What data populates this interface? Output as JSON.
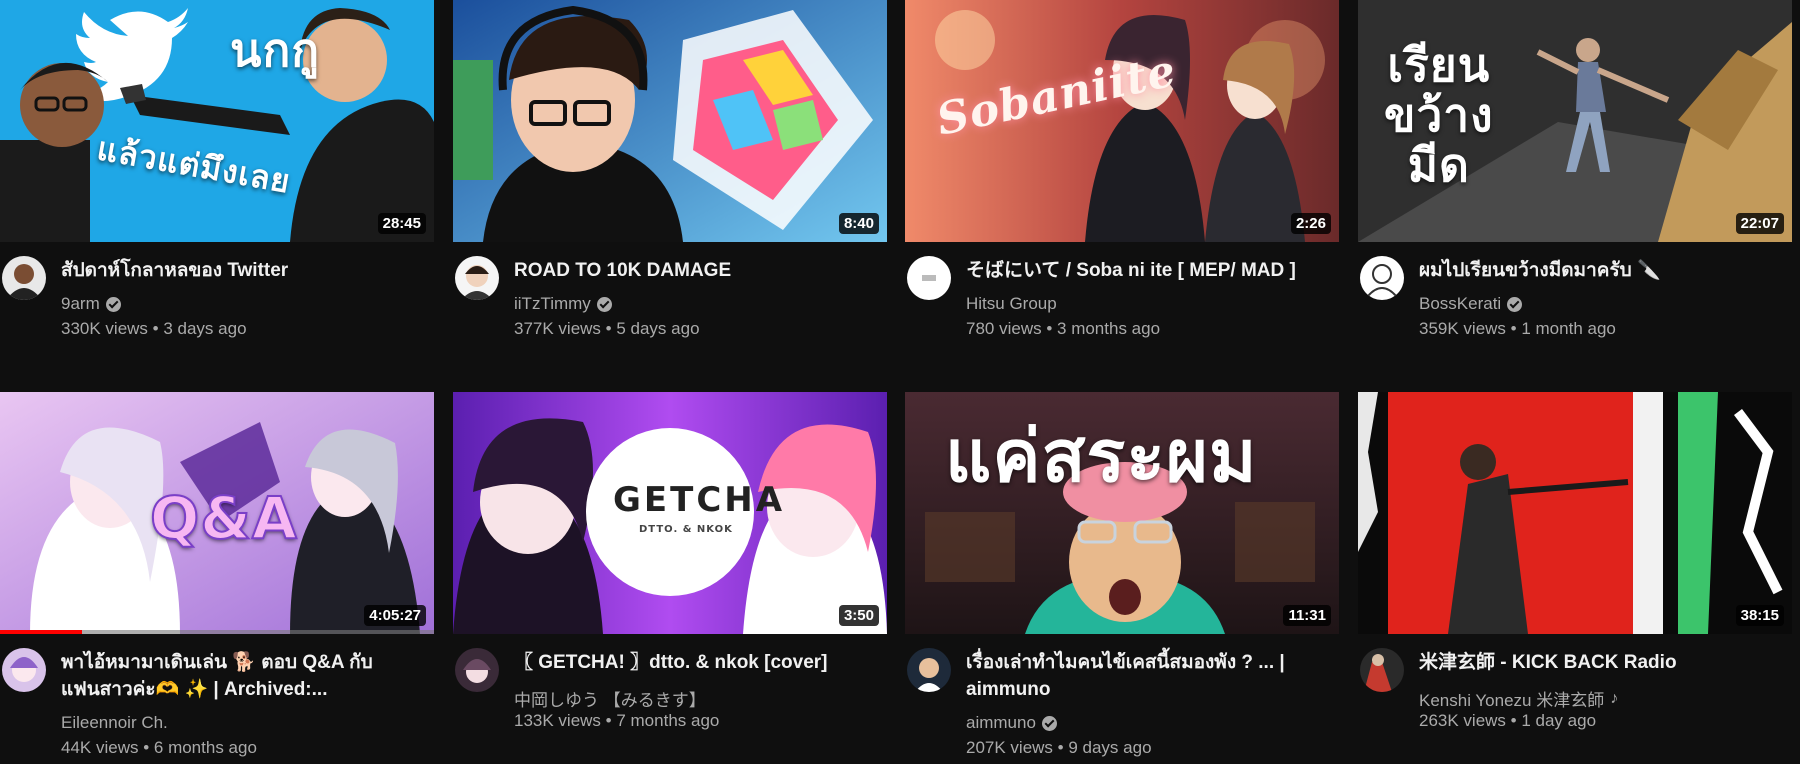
{
  "videos": [
    {
      "title": "สัปดาห์โกลาหลของ Twitter",
      "channel": "9arm",
      "verified": true,
      "views": "330K views",
      "age": "3 days ago",
      "duration": "28:45",
      "thumb_text": "นกกู",
      "thumb_text2": "แล้วแต่มึงเลย",
      "colors": {
        "bg": "#1fa7e6",
        "accent": "#ffffff"
      }
    },
    {
      "title": "ROAD TO 10K DAMAGE",
      "channel": "iiTzTimmy",
      "verified": true,
      "views": "377K views",
      "age": "5 days ago",
      "duration": "8:40",
      "colors": {
        "bg": "#3a7bd5",
        "accent": "#e8c14a"
      }
    },
    {
      "title": "そばにいて / Soba ni ite [ MEP/ MAD ]",
      "channel": "Hitsu Group",
      "verified": false,
      "views": "780 views",
      "age": "3 months ago",
      "duration": "2:26",
      "thumb_text": "Sobaniite",
      "colors": {
        "bg": "#c75a52",
        "accent": "#f6d1a2"
      }
    },
    {
      "title": "ผมไปเรียนขว้างมีดมาครับ 🔪",
      "channel": "BossKerati",
      "verified": true,
      "views": "359K views",
      "age": "1 month ago",
      "duration": "22:07",
      "thumb_text": "เรียน\nขว้าง\nมีด",
      "colors": {
        "bg": "#3b3b3b",
        "accent": "#c29a5b"
      }
    },
    {
      "title": "พาไอ้หมามาเดินเล่น 🐕 ตอบ Q&A กับ\nแฟนสาวค่ะ🫶 ✨ | Archived:...",
      "channel": "Eileennoir Ch.",
      "verified": false,
      "views": "44K views",
      "age": "6 months ago",
      "duration": "4:05:27",
      "thumb_text": "Q&A",
      "progress": 0.19,
      "colors": {
        "bg": "#b88de0",
        "accent": "#7a3fc8"
      }
    },
    {
      "title": "〖 GETCHA! 〗dtto. & nkok [cover]",
      "channel": "中岡しゆう 【みるきす】",
      "verified": false,
      "views": "133K views",
      "age": "7 months ago",
      "duration": "3:50",
      "thumb_text": "GETCHA",
      "thumb_text2": "DTTO. & NKOK",
      "colors": {
        "bg": "#7a2fd0",
        "accent": "#ff6fa8"
      }
    },
    {
      "title": "เรื่องเล่าทำไมคนไข้เคสนี้สมองพัง ? ... |\naimmuno",
      "channel": "aimmuno",
      "verified": true,
      "views": "207K views",
      "age": "9 days ago",
      "duration": "11:31",
      "thumb_text": "แค่สระผม",
      "colors": {
        "bg": "#3a1e28",
        "accent": "#e9506a"
      }
    },
    {
      "title": "米津玄師 - KICK BACK Radio",
      "channel": "Kenshi Yonezu  米津玄師",
      "verified": false,
      "note": "♪",
      "views": "263K views",
      "age": "1 day ago",
      "duration": "38:15",
      "colors": {
        "bg": "#e0231c",
        "accent": "#3cc46b"
      }
    }
  ]
}
